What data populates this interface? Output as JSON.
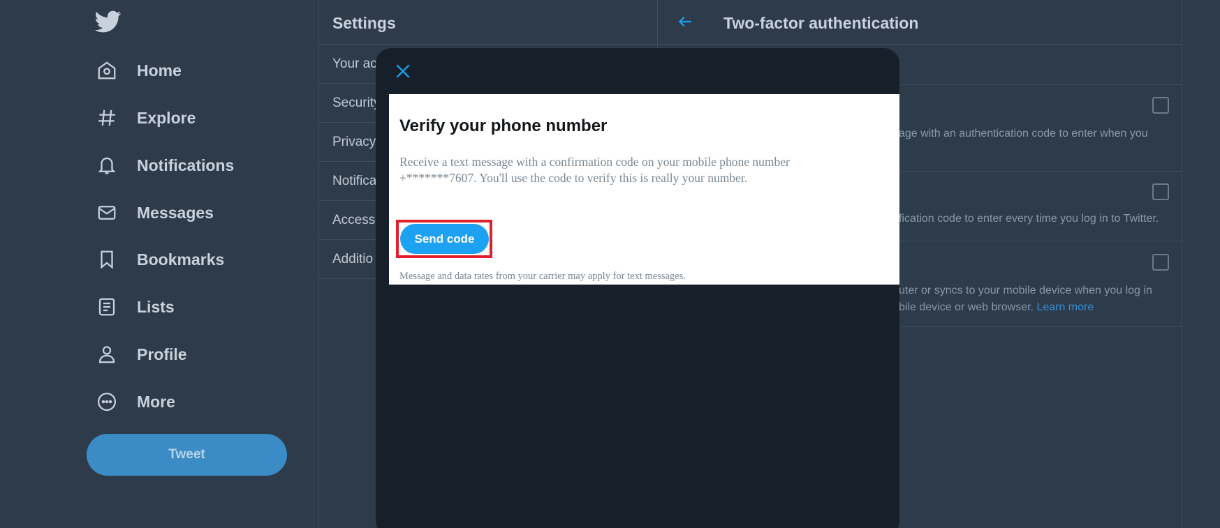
{
  "nav": {
    "items": [
      {
        "label": "Home",
        "icon": "home-icon"
      },
      {
        "label": "Explore",
        "icon": "hashtag-icon"
      },
      {
        "label": "Notifications",
        "icon": "bell-icon"
      },
      {
        "label": "Messages",
        "icon": "envelope-icon"
      },
      {
        "label": "Bookmarks",
        "icon": "bookmark-icon"
      },
      {
        "label": "Lists",
        "icon": "list-icon"
      },
      {
        "label": "Profile",
        "icon": "person-icon"
      },
      {
        "label": "More",
        "icon": "more-icon"
      }
    ],
    "tweet_label": "Tweet"
  },
  "settings": {
    "title": "Settings",
    "rows": [
      "Your ac",
      "Security",
      "Privacy",
      "Notifica",
      "Accessil",
      "Additio"
    ]
  },
  "detail": {
    "title": "Two-factor authentication",
    "rows": [
      {
        "line1": "age with an authentication code to enter when you",
        "line2": ""
      },
      {
        "line1": "fication code to enter every time you log in to Twitter.",
        "line2": ""
      },
      {
        "line1": "uter or syncs to your mobile device when you log in",
        "line2": "bile device or web browser.",
        "link": "Learn more"
      }
    ]
  },
  "modal": {
    "heading": "Verify your phone number",
    "body": "Receive a text message with a confirmation code on your mobile phone number +*******7607. You'll use the code to verify this is really your number.",
    "send_label": "Send code",
    "footnote": "Message and data rates from your carrier may apply for text messages."
  },
  "colors": {
    "background": "#2d3b4b",
    "accent": "#1da1f2",
    "modal_bg": "#17202a",
    "highlight": "#e0202a"
  }
}
